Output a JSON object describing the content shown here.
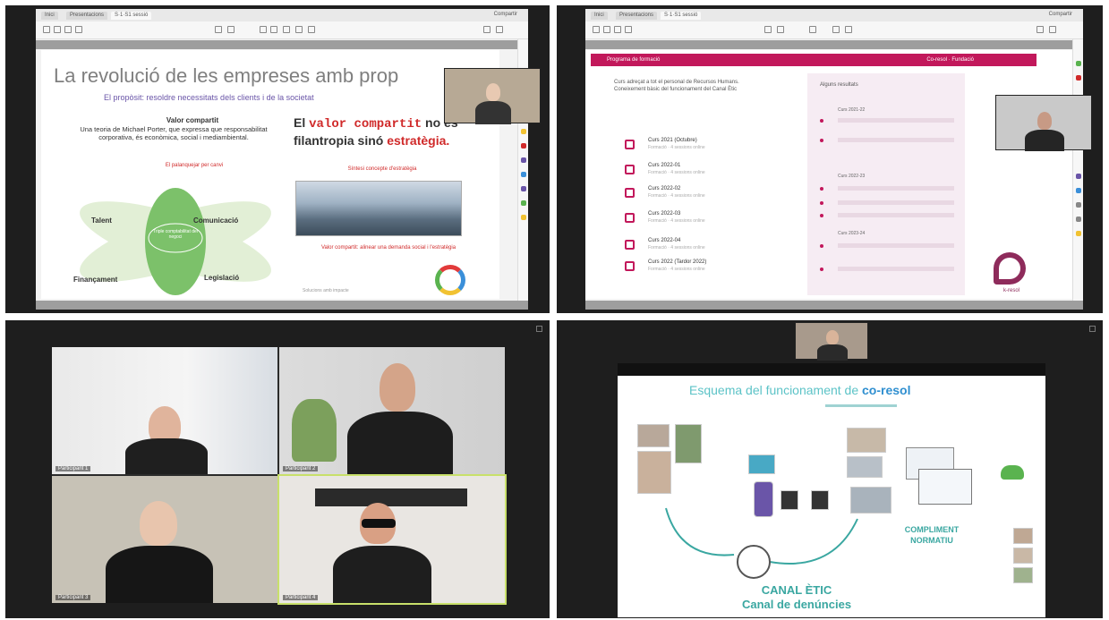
{
  "quadrant1": {
    "tabs": [
      "Inici",
      "Presentacions",
      "S·1·S1 sessió"
    ],
    "tab_right": "Compartir",
    "slide": {
      "title": "La revolució de les empreses amb prop",
      "subtitle": "El propòsit: resoldre necessitats dels clients i de la societat",
      "heading": "Valor compartit",
      "paragraph": "Una teoria de Michael Porter, que expressa que responsabilitat corporativa, és econòmica, social i mediambiental.",
      "red_note": "El palanquejar per canvi",
      "big_statement_a": "El",
      "big_statement_b": "valor compartit",
      "big_statement_c": "no és",
      "big_statement_d": "filantropia sinó",
      "big_statement_e": "estratègia.",
      "small_red": "Síntesi concepte d'estratègia",
      "photo_caption": "Valor compartit: alinear una demanda social i l'estratègia",
      "diagram": {
        "center": "Triple comptabilitat del negoci",
        "top_left": "Talent",
        "top_right": "Comunicació",
        "bottom_left": "Finançament",
        "bottom_right": "Legislació"
      },
      "footer": "Solucions amb impacte"
    }
  },
  "quadrant2": {
    "tabs": [
      "Inici",
      "Presentacions",
      "S·1·S1 sessió"
    ],
    "tab_right": "Compartir",
    "slide": {
      "pink_left": "Programa de formació",
      "pink_right": "Co-resol · Fundació",
      "intro": "Curs adreçat a tot el personal de Recursos Humans. Coneixement bàsic del funcionament del Canal Ètic",
      "items": [
        {
          "t1": "Curs 2021 (Octubre)",
          "t2": "Formació · 4 sessions online"
        },
        {
          "t1": "Curs 2022-01",
          "t2": "Formació · 4 sessions online"
        },
        {
          "t1": "Curs 2022-02",
          "t2": "Formació · 4 sessions online"
        },
        {
          "t1": "Curs 2022-03",
          "t2": "Formació · 4 sessions online"
        },
        {
          "t1": "Curs 2022-04",
          "t2": "Formació · 4 sessions online"
        },
        {
          "t1": "Curs 2022 (Tardor 2022)",
          "t2": "Formació · 4 sessions online"
        }
      ],
      "right_heading": "Alguns resultats",
      "groups": [
        "Curs 2021-22",
        "Curs 2022-23",
        "Curs 2023-24"
      ],
      "logo_text": "k-resol"
    }
  },
  "quadrant3": {
    "participants": [
      "Participant 1",
      "Participant 2",
      "Participant 3",
      "Participant 4"
    ]
  },
  "quadrant4": {
    "slide": {
      "title_a": "Esquema del funcionament de",
      "title_b": "co-resol",
      "canal_line1": "CANAL ÈTIC",
      "canal_line2": "Canal de denúncies",
      "compliment_line1": "COMPLIMENT",
      "compliment_line2": "NORMATIU"
    }
  },
  "colors": {
    "accent_pink": "#c2185b",
    "accent_teal": "#3aa7a1",
    "accent_red": "#d02a2a",
    "diagram_green": "#7cc16a"
  }
}
